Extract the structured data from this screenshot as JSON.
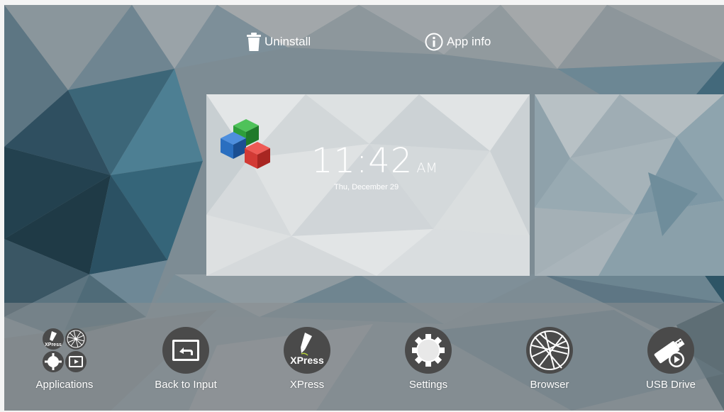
{
  "top_actions": {
    "uninstall_label": "Uninstall",
    "appinfo_label": "App info",
    "uninstall_icon": "trash-icon",
    "appinfo_icon": "info-icon"
  },
  "clock_widget": {
    "time": "11:42",
    "ampm": "AM",
    "date": "Thu, December 29",
    "logo_icon": "cubes-logo-icon"
  },
  "dock": {
    "items": [
      {
        "label": "Applications",
        "icon": "applications-grid-icon"
      },
      {
        "label": "Back to Input",
        "icon": "back-to-input-icon"
      },
      {
        "label": "XPress",
        "icon": "xpress-pen-icon",
        "icon_text": "XPress"
      },
      {
        "label": "Settings",
        "icon": "gear-icon"
      },
      {
        "label": "Browser",
        "icon": "globe-icon"
      },
      {
        "label": "USB Drive",
        "icon": "usb-drive-icon"
      }
    ]
  },
  "colors": {
    "icon_circle": "#4a4a4a",
    "cube_blue": "#2a6fc0",
    "cube_green": "#2e9e3a",
    "cube_red": "#d23a35"
  }
}
